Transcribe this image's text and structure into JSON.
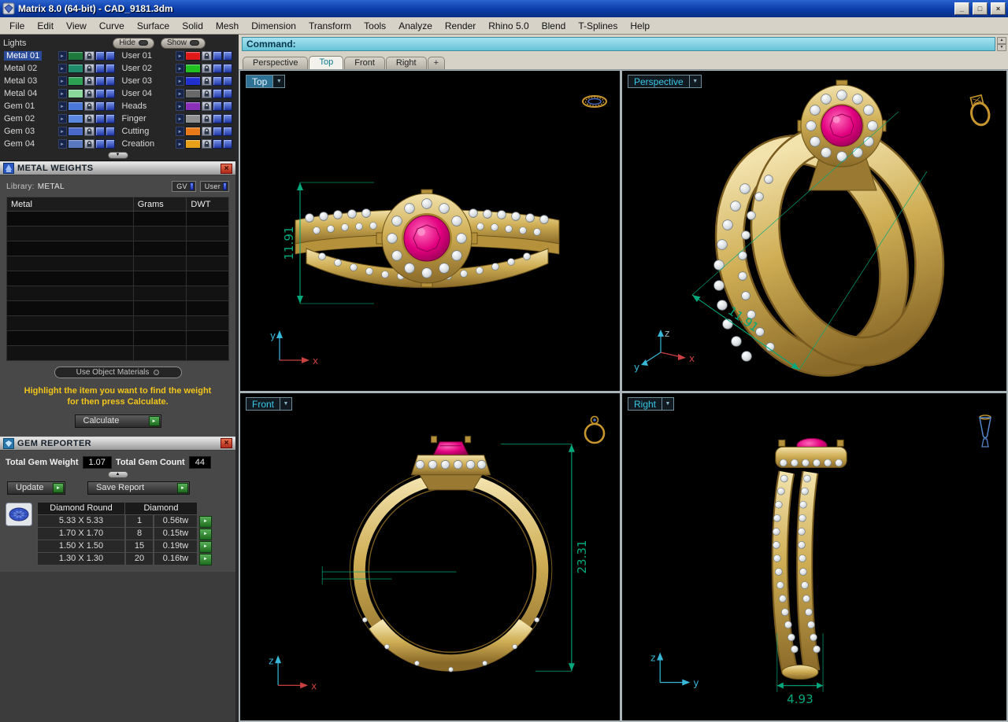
{
  "window": {
    "title": "Matrix 8.0 (64-bit) - CAD_9181.3dm",
    "buttons": {
      "minimize": "_",
      "maximize": "□",
      "close": "×"
    }
  },
  "menu": {
    "items": [
      "File",
      "Edit",
      "View",
      "Curve",
      "Surface",
      "Solid",
      "Mesh",
      "Dimension",
      "Transform",
      "Tools",
      "Analyze",
      "Render",
      "Rhino 5.0",
      "Blend",
      "T-Splines",
      "Help"
    ]
  },
  "layer_panel": {
    "lights_label": "Lights",
    "hide_label": "Hide",
    "show_label": "Show",
    "rows": [
      {
        "left": {
          "label": "Metal 01",
          "color": "#1e7a3c",
          "selected": true
        },
        "right": {
          "label": "User 01",
          "color": "#e01818"
        }
      },
      {
        "left": {
          "label": "Metal 02",
          "color": "#1e8a6a"
        },
        "right": {
          "label": "User 02",
          "color": "#20c020"
        }
      },
      {
        "left": {
          "label": "Metal 03",
          "color": "#2aa050"
        },
        "right": {
          "label": "User 03",
          "color": "#2030d0"
        }
      },
      {
        "left": {
          "label": "Metal 04",
          "color": "#8ad89a"
        },
        "right": {
          "label": "User 04",
          "color": "#686868"
        }
      },
      {
        "left": {
          "label": "Gem 01",
          "color": "#4a78d8"
        },
        "right": {
          "label": "Heads",
          "color": "#8a30b8"
        }
      },
      {
        "left": {
          "label": "Gem 02",
          "color": "#5a88e0"
        },
        "right": {
          "label": "Finger",
          "color": "#909090"
        }
      },
      {
        "left": {
          "label": "Gem 03",
          "color": "#4a68c8"
        },
        "right": {
          "label": "Cutting",
          "color": "#e87818"
        }
      },
      {
        "left": {
          "label": "Gem 04",
          "color": "#5878c0"
        },
        "right": {
          "label": "Creation",
          "color": "#e8a018"
        }
      }
    ]
  },
  "metal_weights": {
    "title": "METAL WEIGHTS",
    "library_label": "Library:",
    "library_value": "METAL",
    "gv_button": "GV",
    "user_button": "User",
    "columns": [
      "Metal",
      "Grams",
      "DWT"
    ],
    "empty_row_count": 10,
    "use_object_materials": "Use Object Materials",
    "instruction_line1": "Highlight the item you want to find the weight",
    "instruction_line2": "for then press Calculate.",
    "calculate_label": "Calculate"
  },
  "gem_reporter": {
    "title": "GEM REPORTER",
    "total_weight_label": "Total Gem Weight",
    "total_weight_value": "1.07",
    "total_count_label": "Total Gem Count",
    "total_count_value": "44",
    "update_label": "Update",
    "save_report_label": "Save Report",
    "col_headers": [
      "Diamond Round",
      "Diamond"
    ],
    "rows": [
      {
        "size": "5.33 X 5.33",
        "count": "1",
        "weight": "0.56tw"
      },
      {
        "size": "1.70 X 1.70",
        "count": "8",
        "weight": "0.15tw"
      },
      {
        "size": "1.50 X 1.50",
        "count": "15",
        "weight": "0.19tw"
      },
      {
        "size": "1.30 X 1.30",
        "count": "20",
        "weight": "0.16tw"
      }
    ]
  },
  "command": {
    "label": "Command:"
  },
  "tabs": {
    "items": [
      "Perspective",
      "Top",
      "Front",
      "Right"
    ],
    "active": "Top",
    "add_tab": "+"
  },
  "viewports": [
    {
      "name": "Top",
      "dimension": "11.91"
    },
    {
      "name": "Perspective",
      "dimension": "11.91"
    },
    {
      "name": "Front",
      "dimension": "23.31"
    },
    {
      "name": "Right",
      "dimension": "4.93"
    }
  ],
  "axes": {
    "x": "x",
    "y": "y",
    "z": "z"
  },
  "colors": {
    "gold": "#c9a94f",
    "gem_magenta": "#d4006e",
    "dimension_green": "#00a87c",
    "command_bar_cyan": "#66c4d8",
    "viewport_label_cyan": "#38c8e8"
  }
}
